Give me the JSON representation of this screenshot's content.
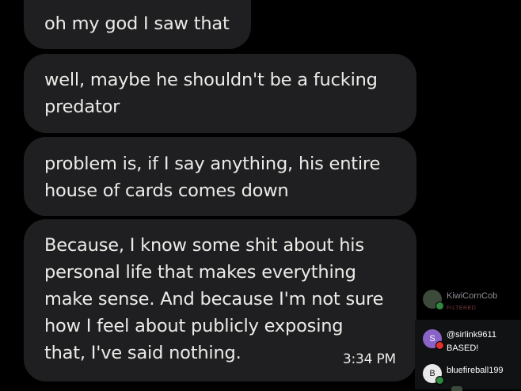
{
  "messages": [
    {
      "text": "oh my god I saw that"
    },
    {
      "text": "well, maybe he shouldn't be a fucking\npredator"
    },
    {
      "text": "problem is, if I say anything, his entire\nhouse of cards comes down"
    },
    {
      "text": "Because, I know some shit about his\npersonal life that makes everything\nmake sense. And because I'm not sure\nhow I feel about publicly exposing\nthat, I've said nothing.",
      "time": "3:34 PM"
    }
  ],
  "chat": [
    {
      "username": "KiwiCornCob",
      "message": "FILTERED",
      "initial": ""
    },
    {
      "username": "@sirlink9611",
      "message": "BASED!",
      "initial": "S"
    },
    {
      "username": "bluefireball199",
      "message": "",
      "initial": "B"
    }
  ],
  "colors": {
    "background": "#000000",
    "bubble": "#1f1f21",
    "text": "#ecebe8"
  }
}
